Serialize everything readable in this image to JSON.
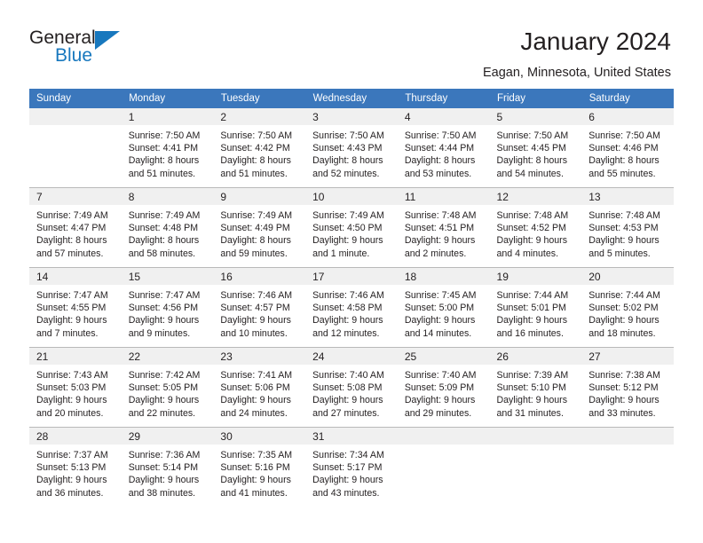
{
  "logo": {
    "word1": "General",
    "word2": "Blue",
    "triangle_color": "#1878be"
  },
  "header": {
    "title": "January 2024",
    "subtitle": "Eagan, Minnesota, United States"
  },
  "theme": {
    "header_blue": "#3b77bc",
    "daynum_band": "#f0f0f0",
    "text": "#231f20",
    "rule": "#b9b9b9"
  },
  "weekdays": [
    "Sunday",
    "Monday",
    "Tuesday",
    "Wednesday",
    "Thursday",
    "Friday",
    "Saturday"
  ],
  "weeks": [
    [
      {
        "day": "",
        "sunrise": "",
        "sunset": "",
        "daylight1": "",
        "daylight2": ""
      },
      {
        "day": "1",
        "sunrise": "Sunrise: 7:50 AM",
        "sunset": "Sunset: 4:41 PM",
        "daylight1": "Daylight: 8 hours",
        "daylight2": "and 51 minutes."
      },
      {
        "day": "2",
        "sunrise": "Sunrise: 7:50 AM",
        "sunset": "Sunset: 4:42 PM",
        "daylight1": "Daylight: 8 hours",
        "daylight2": "and 51 minutes."
      },
      {
        "day": "3",
        "sunrise": "Sunrise: 7:50 AM",
        "sunset": "Sunset: 4:43 PM",
        "daylight1": "Daylight: 8 hours",
        "daylight2": "and 52 minutes."
      },
      {
        "day": "4",
        "sunrise": "Sunrise: 7:50 AM",
        "sunset": "Sunset: 4:44 PM",
        "daylight1": "Daylight: 8 hours",
        "daylight2": "and 53 minutes."
      },
      {
        "day": "5",
        "sunrise": "Sunrise: 7:50 AM",
        "sunset": "Sunset: 4:45 PM",
        "daylight1": "Daylight: 8 hours",
        "daylight2": "and 54 minutes."
      },
      {
        "day": "6",
        "sunrise": "Sunrise: 7:50 AM",
        "sunset": "Sunset: 4:46 PM",
        "daylight1": "Daylight: 8 hours",
        "daylight2": "and 55 minutes."
      }
    ],
    [
      {
        "day": "7",
        "sunrise": "Sunrise: 7:49 AM",
        "sunset": "Sunset: 4:47 PM",
        "daylight1": "Daylight: 8 hours",
        "daylight2": "and 57 minutes."
      },
      {
        "day": "8",
        "sunrise": "Sunrise: 7:49 AM",
        "sunset": "Sunset: 4:48 PM",
        "daylight1": "Daylight: 8 hours",
        "daylight2": "and 58 minutes."
      },
      {
        "day": "9",
        "sunrise": "Sunrise: 7:49 AM",
        "sunset": "Sunset: 4:49 PM",
        "daylight1": "Daylight: 8 hours",
        "daylight2": "and 59 minutes."
      },
      {
        "day": "10",
        "sunrise": "Sunrise: 7:49 AM",
        "sunset": "Sunset: 4:50 PM",
        "daylight1": "Daylight: 9 hours",
        "daylight2": "and 1 minute."
      },
      {
        "day": "11",
        "sunrise": "Sunrise: 7:48 AM",
        "sunset": "Sunset: 4:51 PM",
        "daylight1": "Daylight: 9 hours",
        "daylight2": "and 2 minutes."
      },
      {
        "day": "12",
        "sunrise": "Sunrise: 7:48 AM",
        "sunset": "Sunset: 4:52 PM",
        "daylight1": "Daylight: 9 hours",
        "daylight2": "and 4 minutes."
      },
      {
        "day": "13",
        "sunrise": "Sunrise: 7:48 AM",
        "sunset": "Sunset: 4:53 PM",
        "daylight1": "Daylight: 9 hours",
        "daylight2": "and 5 minutes."
      }
    ],
    [
      {
        "day": "14",
        "sunrise": "Sunrise: 7:47 AM",
        "sunset": "Sunset: 4:55 PM",
        "daylight1": "Daylight: 9 hours",
        "daylight2": "and 7 minutes."
      },
      {
        "day": "15",
        "sunrise": "Sunrise: 7:47 AM",
        "sunset": "Sunset: 4:56 PM",
        "daylight1": "Daylight: 9 hours",
        "daylight2": "and 9 minutes."
      },
      {
        "day": "16",
        "sunrise": "Sunrise: 7:46 AM",
        "sunset": "Sunset: 4:57 PM",
        "daylight1": "Daylight: 9 hours",
        "daylight2": "and 10 minutes."
      },
      {
        "day": "17",
        "sunrise": "Sunrise: 7:46 AM",
        "sunset": "Sunset: 4:58 PM",
        "daylight1": "Daylight: 9 hours",
        "daylight2": "and 12 minutes."
      },
      {
        "day": "18",
        "sunrise": "Sunrise: 7:45 AM",
        "sunset": "Sunset: 5:00 PM",
        "daylight1": "Daylight: 9 hours",
        "daylight2": "and 14 minutes."
      },
      {
        "day": "19",
        "sunrise": "Sunrise: 7:44 AM",
        "sunset": "Sunset: 5:01 PM",
        "daylight1": "Daylight: 9 hours",
        "daylight2": "and 16 minutes."
      },
      {
        "day": "20",
        "sunrise": "Sunrise: 7:44 AM",
        "sunset": "Sunset: 5:02 PM",
        "daylight1": "Daylight: 9 hours",
        "daylight2": "and 18 minutes."
      }
    ],
    [
      {
        "day": "21",
        "sunrise": "Sunrise: 7:43 AM",
        "sunset": "Sunset: 5:03 PM",
        "daylight1": "Daylight: 9 hours",
        "daylight2": "and 20 minutes."
      },
      {
        "day": "22",
        "sunrise": "Sunrise: 7:42 AM",
        "sunset": "Sunset: 5:05 PM",
        "daylight1": "Daylight: 9 hours",
        "daylight2": "and 22 minutes."
      },
      {
        "day": "23",
        "sunrise": "Sunrise: 7:41 AM",
        "sunset": "Sunset: 5:06 PM",
        "daylight1": "Daylight: 9 hours",
        "daylight2": "and 24 minutes."
      },
      {
        "day": "24",
        "sunrise": "Sunrise: 7:40 AM",
        "sunset": "Sunset: 5:08 PM",
        "daylight1": "Daylight: 9 hours",
        "daylight2": "and 27 minutes."
      },
      {
        "day": "25",
        "sunrise": "Sunrise: 7:40 AM",
        "sunset": "Sunset: 5:09 PM",
        "daylight1": "Daylight: 9 hours",
        "daylight2": "and 29 minutes."
      },
      {
        "day": "26",
        "sunrise": "Sunrise: 7:39 AM",
        "sunset": "Sunset: 5:10 PM",
        "daylight1": "Daylight: 9 hours",
        "daylight2": "and 31 minutes."
      },
      {
        "day": "27",
        "sunrise": "Sunrise: 7:38 AM",
        "sunset": "Sunset: 5:12 PM",
        "daylight1": "Daylight: 9 hours",
        "daylight2": "and 33 minutes."
      }
    ],
    [
      {
        "day": "28",
        "sunrise": "Sunrise: 7:37 AM",
        "sunset": "Sunset: 5:13 PM",
        "daylight1": "Daylight: 9 hours",
        "daylight2": "and 36 minutes."
      },
      {
        "day": "29",
        "sunrise": "Sunrise: 7:36 AM",
        "sunset": "Sunset: 5:14 PM",
        "daylight1": "Daylight: 9 hours",
        "daylight2": "and 38 minutes."
      },
      {
        "day": "30",
        "sunrise": "Sunrise: 7:35 AM",
        "sunset": "Sunset: 5:16 PM",
        "daylight1": "Daylight: 9 hours",
        "daylight2": "and 41 minutes."
      },
      {
        "day": "31",
        "sunrise": "Sunrise: 7:34 AM",
        "sunset": "Sunset: 5:17 PM",
        "daylight1": "Daylight: 9 hours",
        "daylight2": "and 43 minutes."
      },
      {
        "day": "",
        "sunrise": "",
        "sunset": "",
        "daylight1": "",
        "daylight2": ""
      },
      {
        "day": "",
        "sunrise": "",
        "sunset": "",
        "daylight1": "",
        "daylight2": ""
      },
      {
        "day": "",
        "sunrise": "",
        "sunset": "",
        "daylight1": "",
        "daylight2": ""
      }
    ]
  ]
}
